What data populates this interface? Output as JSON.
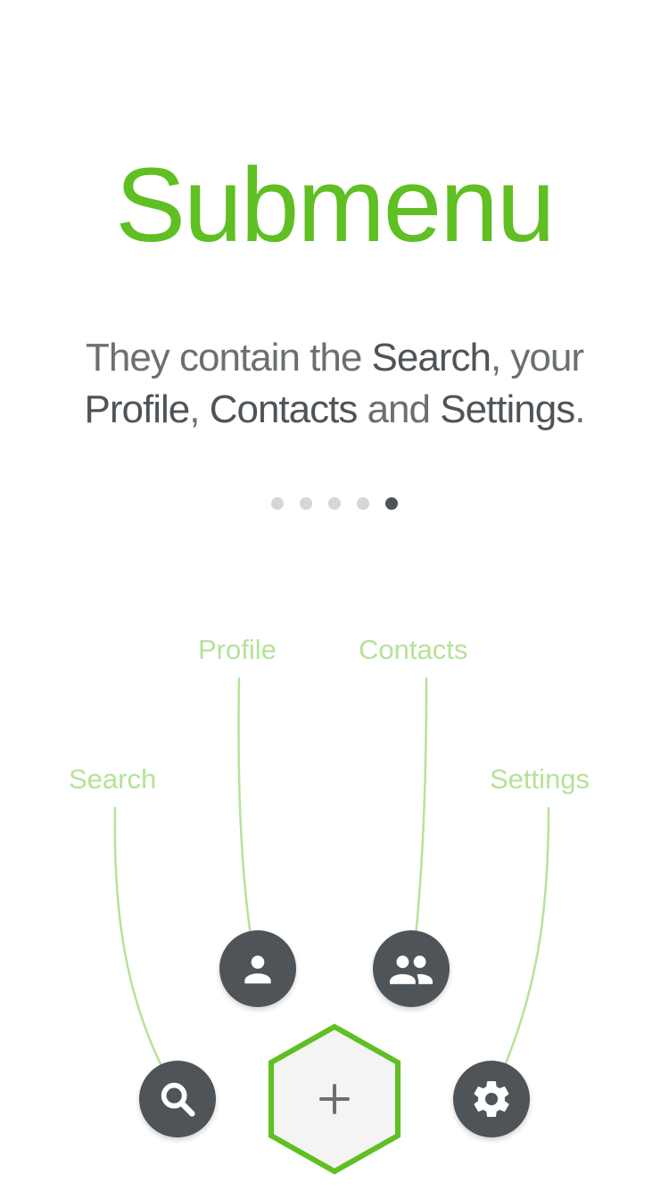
{
  "title": "Submenu",
  "description": {
    "part1": "They contain the ",
    "search": "Search",
    "part2": ", your ",
    "profile": "Profile",
    "sep": ", ",
    "contacts": "Contacts",
    "part3": " and ",
    "settings": "Settings",
    "end": "."
  },
  "pager": {
    "total": 5,
    "active": 5
  },
  "callouts": {
    "search": "Search",
    "profile": "Profile",
    "contacts": "Contacts",
    "settings": "Settings"
  },
  "buttons": {
    "search_icon": "search-icon",
    "profile_icon": "person-icon",
    "contacts_icon": "people-icon",
    "settings_icon": "gear-icon",
    "add_icon": "plus-icon"
  },
  "colors": {
    "accent": "#5fbf23",
    "callout": "#b6e29a",
    "button": "#4f5458",
    "text": "#6b6f72",
    "dot": "#d4d6d7",
    "dot_active": "#4f5458",
    "hex_fill": "#f4f4f4"
  }
}
